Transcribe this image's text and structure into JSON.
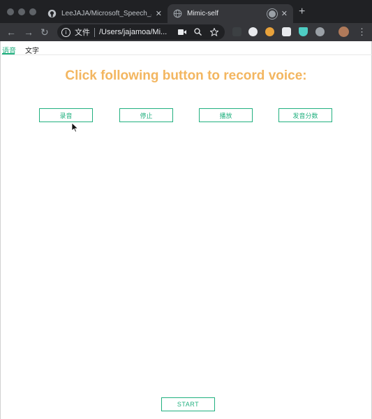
{
  "browser": {
    "tabs": [
      {
        "title": "LeeJAJA/Microsoft_Speech_API",
        "close": "✕"
      },
      {
        "title": "Mimic-self",
        "close": "✕"
      }
    ],
    "new_tab": "+",
    "omnibox": {
      "scheme_label": "文件",
      "url": "/Users/jajamoa/Mi..."
    },
    "nav": {
      "back": "←",
      "forward": "→",
      "reload": "↻"
    },
    "menu": "⋮"
  },
  "page_tabs": {
    "voice": "语音",
    "text": "文字"
  },
  "main": {
    "headline": "Click following button to record voice:",
    "buttons": {
      "record": "录音",
      "stop": "停止",
      "play": "播放",
      "score": "发音分数"
    },
    "start": "START"
  },
  "colors": {
    "accent": "#21b07f",
    "headline": "#f3b660",
    "chrome_dark": "#202124",
    "chrome_toolbar": "#35363a"
  },
  "icons": [
    "github-icon",
    "globe-icon",
    "audio-playing-icon",
    "info-icon",
    "camera-icon",
    "zoom-icon",
    "star-icon",
    "extension-icon",
    "avatar",
    "menu-icon"
  ]
}
